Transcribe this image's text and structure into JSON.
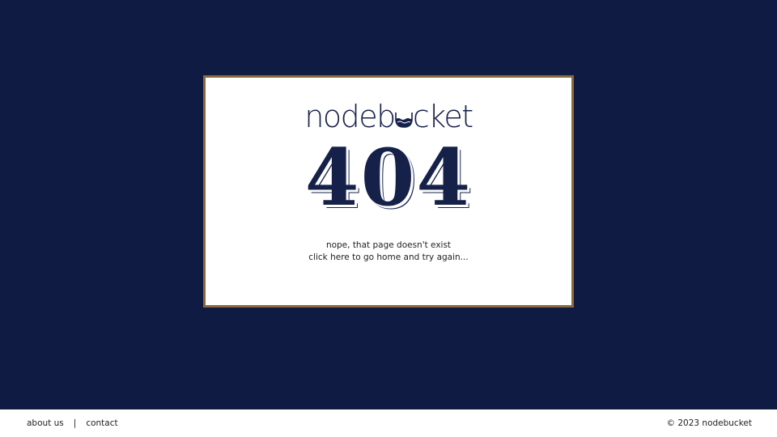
{
  "logo": {
    "text_before": "nodeb",
    "text_after": "cket"
  },
  "error": {
    "code": "404",
    "line1": "nope, that page doesn't exist",
    "line2": "click here to go home and try again..."
  },
  "footer": {
    "links": [
      "about us",
      "contact"
    ],
    "separator": "|",
    "copyright": "© 2023 nodebucket"
  },
  "colors": {
    "background": "#0f1b42",
    "card_border": "#8a6a3a",
    "text_dark": "#16214a"
  }
}
